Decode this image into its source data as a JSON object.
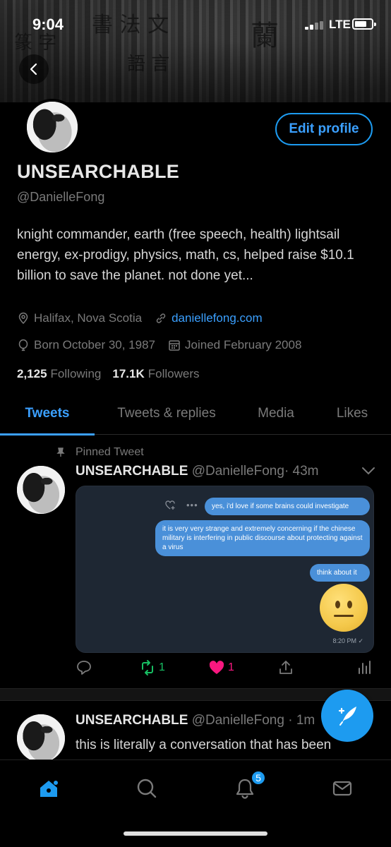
{
  "status_bar": {
    "time": "9:04",
    "network": "LTE"
  },
  "profile": {
    "edit_profile_label": "Edit profile",
    "display_name": "UNSEARCHABLE",
    "handle": "@DanielleFong",
    "bio": "knight commander, earth (free speech, health) lightsail energy, ex-prodigy, physics, math, cs, helped raise $10.1 billion to save the planet. not done yet...",
    "location": "Halifax, Nova Scotia",
    "website": "daniellefong.com",
    "birthday": "Born October 30, 1987",
    "joined": "Joined February 2008",
    "following_count": "2,125",
    "following_label": "Following",
    "followers_count": "17.1K",
    "followers_label": "Followers"
  },
  "tabs": [
    "Tweets",
    "Tweets & replies",
    "Media",
    "Likes"
  ],
  "active_tab": "Tweets",
  "pinned_tweet": {
    "pinned_label": "Pinned Tweet",
    "author": "UNSEARCHABLE",
    "handle": "@DanielleFong",
    "time": "· 43m",
    "media": {
      "messages": [
        "yes, i'd love if some brains could investigate",
        "it is very very strange and extremely concerning if the chinese military is interfering in public discourse about protecting against a virus",
        "think about it"
      ],
      "time": "8:20 PM ✓"
    },
    "retweets": "1",
    "likes": "1"
  },
  "second_tweet": {
    "author": "UNSEARCHABLE",
    "handle": "@DanielleFong · 1m",
    "text": "this is literally a conversation that has been happening perpetually for the past — what"
  },
  "bottom_nav": {
    "notifications_badge": "5"
  },
  "colors": {
    "accent": "#1d9bf0",
    "like": "#f91880",
    "retweet": "#17bf63",
    "background": "#000000"
  },
  "icons": [
    "back-arrow-icon",
    "location-icon",
    "link-icon",
    "balloon-icon",
    "calendar-icon",
    "pin-icon",
    "chevron-down-icon",
    "reply-icon",
    "retweet-icon",
    "heart-icon",
    "share-icon",
    "analytics-icon",
    "compose-icon",
    "home-icon",
    "search-icon",
    "bell-icon",
    "mail-icon"
  ]
}
